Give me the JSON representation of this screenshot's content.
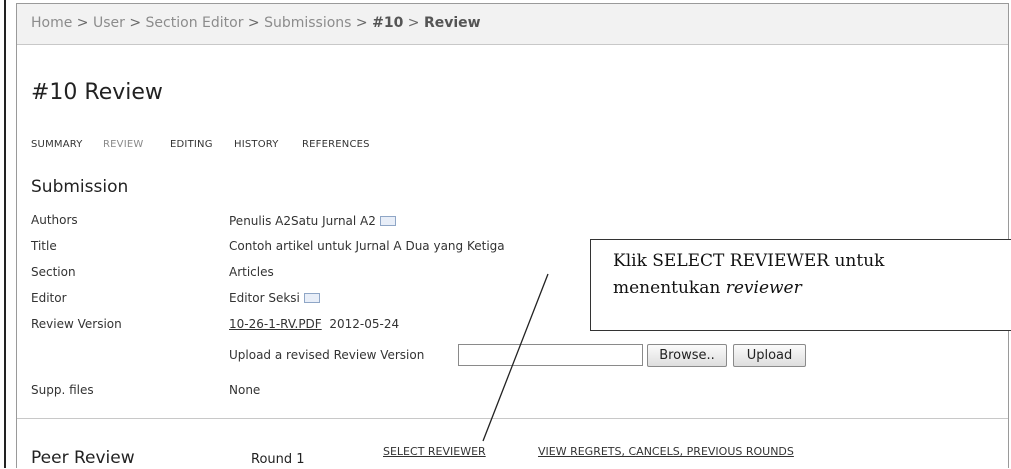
{
  "breadcrumb": {
    "home": "Home",
    "user": "User",
    "section_editor": "Section Editor",
    "submissions": "Submissions",
    "id": "#10",
    "current": "Review",
    "separator": " > "
  },
  "page_title": "#10 Review",
  "tabs": [
    {
      "label": "SUMMARY",
      "active": false
    },
    {
      "label": "REVIEW",
      "active": true
    },
    {
      "label": "EDITING",
      "active": false
    },
    {
      "label": "HISTORY",
      "active": false
    },
    {
      "label": "REFERENCES",
      "active": false
    }
  ],
  "submission": {
    "heading": "Submission",
    "authors_label": "Authors",
    "authors_value": "Penulis A2Satu Jurnal A2",
    "title_label": "Title",
    "title_value": "Contoh artikel untuk Jurnal A Dua yang Ketiga",
    "section_label": "Section",
    "section_value": "Articles",
    "editor_label": "Editor",
    "editor_value": "Editor Seksi",
    "review_version_label": "Review Version",
    "review_file": "10-26-1-RV.PDF",
    "review_date": "2012-05-24",
    "upload_label": "Upload a revised Review Version",
    "browse_label": "Browse..",
    "upload_button": "Upload",
    "supp_label": "Supp. files",
    "supp_value": "None"
  },
  "callout": {
    "line1": "Klik SELECT REVIEWER untuk",
    "line2_prefix": "menentukan ",
    "line2_emph": "reviewer"
  },
  "peer_review": {
    "heading": "Peer Review",
    "round": "Round 1",
    "select_reviewer": "SELECT REVIEWER",
    "view_regrets": "VIEW REGRETS, CANCELS, PREVIOUS ROUNDS"
  },
  "icons": {
    "email": "envelope-icon"
  },
  "colors": {
    "breadcrumb_bg": "#f2f2f2",
    "breadcrumb_text": "#8c8c8c",
    "active_tab": "#888888",
    "text": "#333333"
  }
}
